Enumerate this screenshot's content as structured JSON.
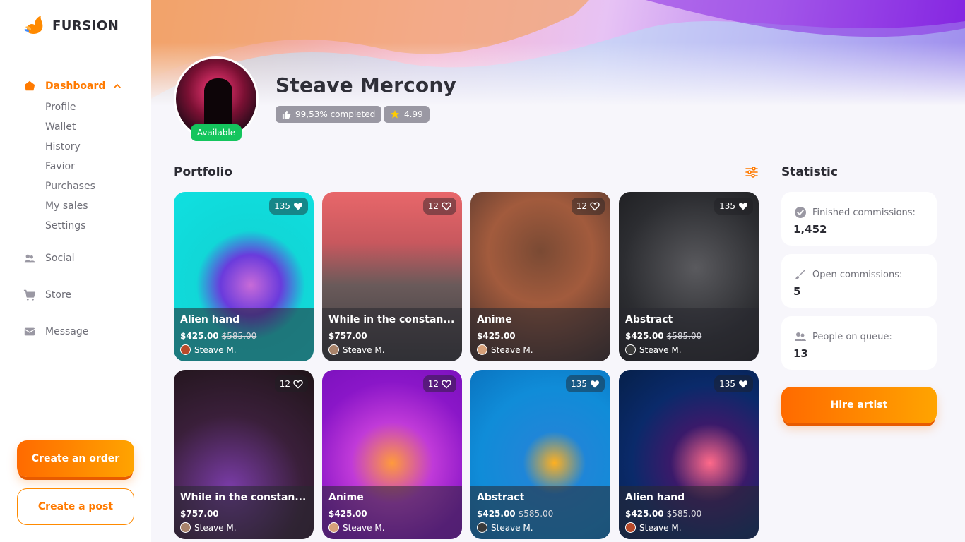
{
  "brand": {
    "name": "FURSION"
  },
  "sidebar": {
    "dashboard": "Dashboard",
    "sub_items": [
      "Profile",
      "Wallet",
      "History",
      "Favior",
      "Purchases",
      "My sales",
      "Settings"
    ],
    "social": "Social",
    "store": "Store",
    "message": "Message",
    "create_order": "Create an order",
    "create_post": "Create a post"
  },
  "profile": {
    "name": "Steave Mercony",
    "status": "Available",
    "completed": "99,53% completed",
    "rating": "4.99"
  },
  "portfolio": {
    "title": "Portfolio",
    "cards": [
      {
        "title": "Alien hand",
        "price": "$425.00",
        "old_price": "$585.00",
        "likes": "135",
        "liked": true,
        "author": "Steave M."
      },
      {
        "title": "While in the constan...",
        "price": "$757.00",
        "old_price": "",
        "likes": "12",
        "liked": false,
        "author": "Steave M."
      },
      {
        "title": "Anime",
        "price": "$425.00",
        "old_price": "",
        "likes": "12",
        "liked": false,
        "author": "Steave M."
      },
      {
        "title": "Abstract",
        "price": "$425.00",
        "old_price": "$585.00",
        "likes": "135",
        "liked": true,
        "author": "Steave M."
      },
      {
        "title": "While in the constan...",
        "price": "$757.00",
        "old_price": "",
        "likes": "12",
        "liked": false,
        "author": "Steave M."
      },
      {
        "title": "Anime",
        "price": "$425.00",
        "old_price": "",
        "likes": "12",
        "liked": false,
        "author": "Steave M."
      },
      {
        "title": "Abstract",
        "price": "$425.00",
        "old_price": "$585.00",
        "likes": "135",
        "liked": true,
        "author": "Steave M."
      },
      {
        "title": "Alien hand",
        "price": "$425.00",
        "old_price": "$585.00",
        "likes": "135",
        "liked": true,
        "author": "Steave M."
      }
    ]
  },
  "statistic": {
    "title": "Statistic",
    "finished_label": "Finished commissions:",
    "finished_value": "1,452",
    "open_label": "Open commissions:",
    "open_value": "5",
    "queue_label": "People on queue:",
    "queue_value": "13",
    "hire": "Hire artist"
  },
  "colors": {
    "accent": "#ff7a00",
    "available": "#14c55d"
  }
}
